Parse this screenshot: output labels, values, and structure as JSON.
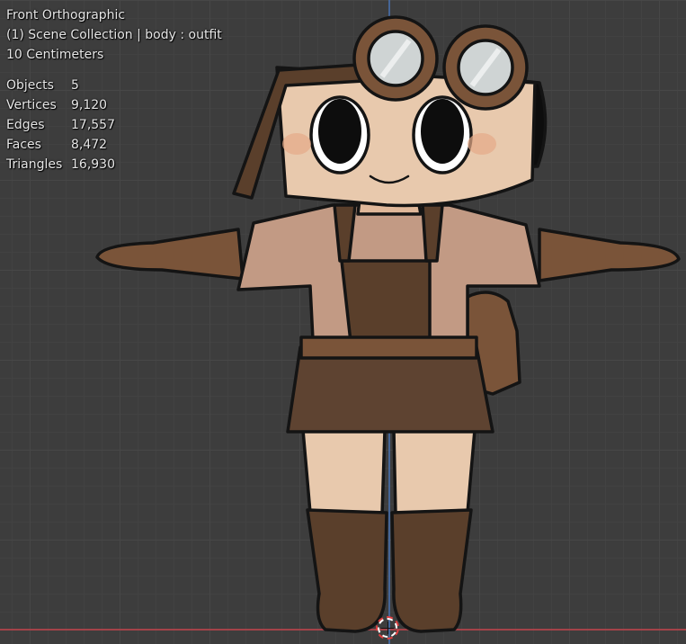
{
  "viewport": {
    "view_name": "Front Orthographic",
    "collection_info": "(1) Scene Collection | body : outfit",
    "grid_scale": "10 Centimeters"
  },
  "stats": [
    {
      "label": "Objects",
      "value": "5"
    },
    {
      "label": "Vertices",
      "value": "9,120"
    },
    {
      "label": "Edges",
      "value": "17,557"
    },
    {
      "label": "Faces",
      "value": "8,472"
    },
    {
      "label": "Triangles",
      "value": "16,930"
    }
  ],
  "colors": {
    "background": "#3d3d3d",
    "axis_x": "#b5434a",
    "axis_z": "#4772b3",
    "skin": "#e8c9ad",
    "shirt": "#c29a84",
    "brown_dark": "#5a3f2b",
    "brown_mid": "#7a5439",
    "outline": "#141414"
  }
}
